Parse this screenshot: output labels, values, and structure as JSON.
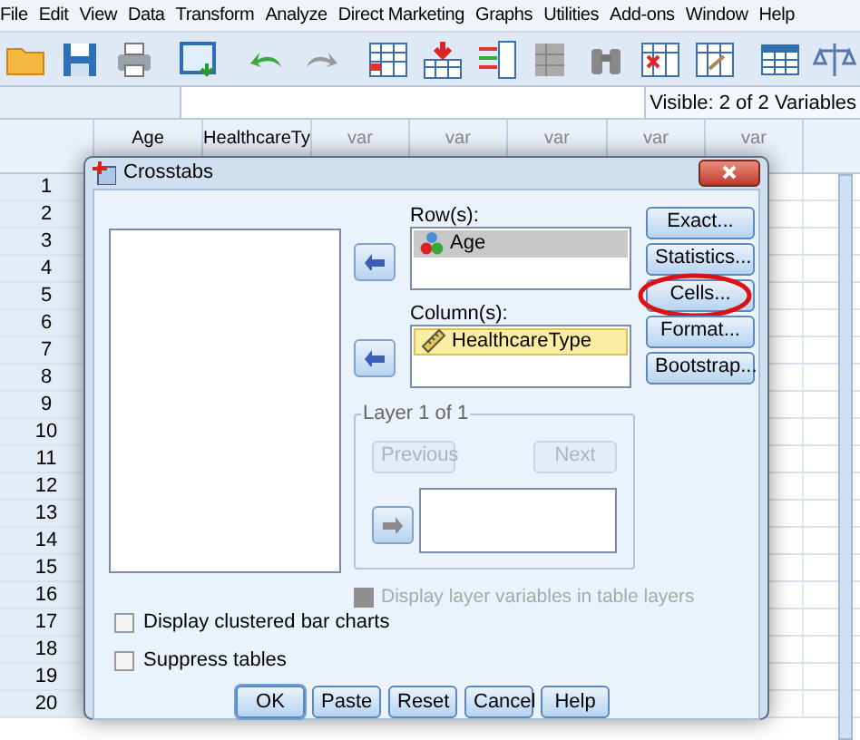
{
  "menu": [
    "File",
    "Edit",
    "View",
    "Data",
    "Transform",
    "Analyze",
    "Direct Marketing",
    "Graphs",
    "Utilities",
    "Add-ons",
    "Window",
    "Help"
  ],
  "variable_bar": {
    "visible": "Visible: 2 of 2 Variables"
  },
  "grid": {
    "columns": [
      "Age",
      "HealthcareTy",
      "var",
      "var",
      "var",
      "var",
      "var"
    ],
    "rows": [
      "1",
      "2",
      "3",
      "4",
      "5",
      "6",
      "7",
      "8",
      "9",
      "10",
      "11",
      "12",
      "13",
      "14",
      "15",
      "16",
      "17",
      "18",
      "19",
      "20"
    ]
  },
  "dialog": {
    "title": "Crosstabs",
    "rows_label": "Row(s):",
    "rows": [
      {
        "name": "Age",
        "kind": "nominal",
        "selected": true
      }
    ],
    "columns_label": "Column(s):",
    "columns": [
      {
        "name": "HealthcareType",
        "kind": "scale",
        "selected": true
      }
    ],
    "side_buttons": [
      {
        "label": "Exact...",
        "circled": false
      },
      {
        "label": "Statistics...",
        "circled": false
      },
      {
        "label": "Cells...",
        "circled": true
      },
      {
        "label": "Format...",
        "circled": false
      },
      {
        "label": "Bootstrap...",
        "circled": false
      }
    ],
    "layer": {
      "title": "Layer 1 of 1",
      "previous": {
        "label": "Previous",
        "disabled": true
      },
      "next": {
        "label": "Next",
        "disabled": true
      }
    },
    "layer_option": {
      "label": "Display layer variables in table layers",
      "checked": false,
      "disabled": true
    },
    "options": [
      {
        "label": "Display clustered bar charts",
        "checked": false
      },
      {
        "label": "Suppress tables",
        "checked": false
      }
    ],
    "buttons": [
      {
        "label": "OK",
        "default": true
      },
      {
        "label": "Paste",
        "default": false
      },
      {
        "label": "Reset",
        "default": false
      },
      {
        "label": "Cancel",
        "default": false
      },
      {
        "label": "Help",
        "default": false
      }
    ]
  }
}
